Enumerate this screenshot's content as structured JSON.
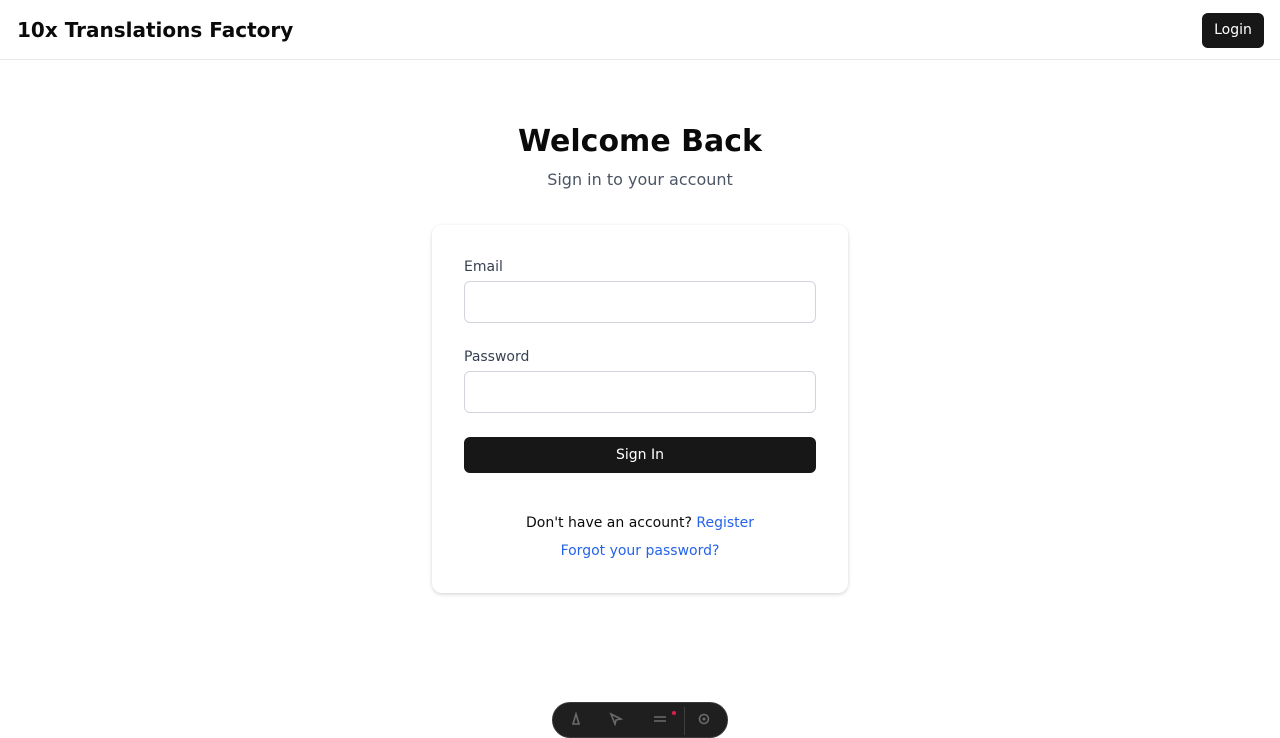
{
  "header": {
    "brand": "10x Translations Factory",
    "login_label": "Login"
  },
  "main": {
    "title": "Welcome Back",
    "subtitle": "Sign in to your account"
  },
  "form": {
    "email_label": "Email",
    "email_value": "",
    "email_placeholder": "",
    "password_label": "Password",
    "password_value": "",
    "password_placeholder": "",
    "signin_label": "Sign In",
    "no_account_text": "Don't have an account?",
    "register_label": "Register",
    "forgot_label": "Forgot your password?"
  },
  "dev_toolbar": {
    "icons": [
      "astro-icon",
      "inspect-icon",
      "audit-icon",
      "settings-icon"
    ]
  },
  "colors": {
    "primary_button": "#171717",
    "link": "#2563eb",
    "border": "#e5e7eb",
    "muted_text": "#4b5563"
  }
}
